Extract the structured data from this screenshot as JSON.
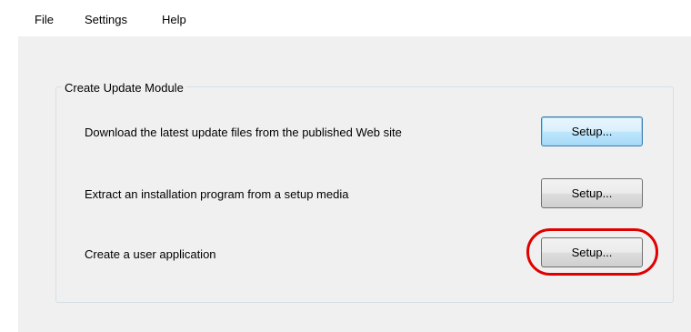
{
  "menu": {
    "file": "File",
    "settings": "Settings",
    "help": "Help"
  },
  "group": {
    "title": "Create Update Module",
    "rows": [
      {
        "label": "Download the latest update files from the published Web site",
        "button": "Setup..."
      },
      {
        "label": "Extract an installation program from a setup media",
        "button": "Setup..."
      },
      {
        "label": "Create a user application",
        "button": "Setup..."
      }
    ]
  },
  "annotation": {
    "color": "#e00000",
    "target": "Create a user application Setup button"
  }
}
